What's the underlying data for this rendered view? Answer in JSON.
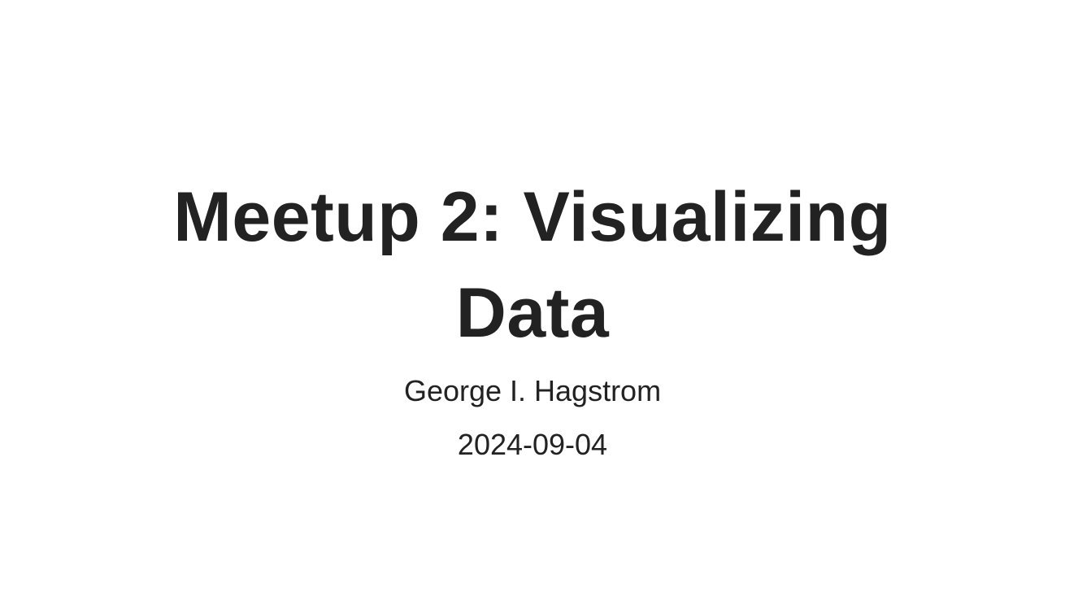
{
  "slide": {
    "title_lines": [
      "Meetup 2: Visualizing",
      "Data"
    ],
    "author": "George I. Hagstrom",
    "date": "2024-09-04"
  },
  "colors": {
    "background": "#ffffff",
    "text": "#222222"
  }
}
